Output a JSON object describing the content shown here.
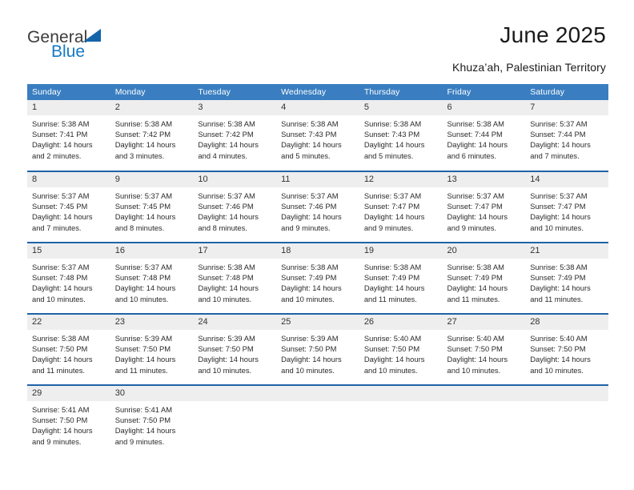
{
  "brand": {
    "name_top": "General",
    "name_bottom": "Blue",
    "triangle_color": "#1464aa",
    "blue_color": "#1479c4"
  },
  "header": {
    "title": "June 2025",
    "subtitle": "Khuza’ah, Palestinian Territory"
  },
  "theme": {
    "header_bg": "#3a7ec1",
    "row_rule": "#1f64a8",
    "daynum_bg": "#eeeeee"
  },
  "weekday_headers": [
    "Sunday",
    "Monday",
    "Tuesday",
    "Wednesday",
    "Thursday",
    "Friday",
    "Saturday"
  ],
  "weeks": [
    [
      {
        "day": "1",
        "text": "Sunrise: 5:38 AM\nSunset: 7:41 PM\nDaylight: 14 hours\nand 2 minutes."
      },
      {
        "day": "2",
        "text": "Sunrise: 5:38 AM\nSunset: 7:42 PM\nDaylight: 14 hours\nand 3 minutes."
      },
      {
        "day": "3",
        "text": "Sunrise: 5:38 AM\nSunset: 7:42 PM\nDaylight: 14 hours\nand 4 minutes."
      },
      {
        "day": "4",
        "text": "Sunrise: 5:38 AM\nSunset: 7:43 PM\nDaylight: 14 hours\nand 5 minutes."
      },
      {
        "day": "5",
        "text": "Sunrise: 5:38 AM\nSunset: 7:43 PM\nDaylight: 14 hours\nand 5 minutes."
      },
      {
        "day": "6",
        "text": "Sunrise: 5:38 AM\nSunset: 7:44 PM\nDaylight: 14 hours\nand 6 minutes."
      },
      {
        "day": "7",
        "text": "Sunrise: 5:37 AM\nSunset: 7:44 PM\nDaylight: 14 hours\nand 7 minutes."
      }
    ],
    [
      {
        "day": "8",
        "text": "Sunrise: 5:37 AM\nSunset: 7:45 PM\nDaylight: 14 hours\nand 7 minutes."
      },
      {
        "day": "9",
        "text": "Sunrise: 5:37 AM\nSunset: 7:45 PM\nDaylight: 14 hours\nand 8 minutes."
      },
      {
        "day": "10",
        "text": "Sunrise: 5:37 AM\nSunset: 7:46 PM\nDaylight: 14 hours\nand 8 minutes."
      },
      {
        "day": "11",
        "text": "Sunrise: 5:37 AM\nSunset: 7:46 PM\nDaylight: 14 hours\nand 9 minutes."
      },
      {
        "day": "12",
        "text": "Sunrise: 5:37 AM\nSunset: 7:47 PM\nDaylight: 14 hours\nand 9 minutes."
      },
      {
        "day": "13",
        "text": "Sunrise: 5:37 AM\nSunset: 7:47 PM\nDaylight: 14 hours\nand 9 minutes."
      },
      {
        "day": "14",
        "text": "Sunrise: 5:37 AM\nSunset: 7:47 PM\nDaylight: 14 hours\nand 10 minutes."
      }
    ],
    [
      {
        "day": "15",
        "text": "Sunrise: 5:37 AM\nSunset: 7:48 PM\nDaylight: 14 hours\nand 10 minutes."
      },
      {
        "day": "16",
        "text": "Sunrise: 5:37 AM\nSunset: 7:48 PM\nDaylight: 14 hours\nand 10 minutes."
      },
      {
        "day": "17",
        "text": "Sunrise: 5:38 AM\nSunset: 7:48 PM\nDaylight: 14 hours\nand 10 minutes."
      },
      {
        "day": "18",
        "text": "Sunrise: 5:38 AM\nSunset: 7:49 PM\nDaylight: 14 hours\nand 10 minutes."
      },
      {
        "day": "19",
        "text": "Sunrise: 5:38 AM\nSunset: 7:49 PM\nDaylight: 14 hours\nand 11 minutes."
      },
      {
        "day": "20",
        "text": "Sunrise: 5:38 AM\nSunset: 7:49 PM\nDaylight: 14 hours\nand 11 minutes."
      },
      {
        "day": "21",
        "text": "Sunrise: 5:38 AM\nSunset: 7:49 PM\nDaylight: 14 hours\nand 11 minutes."
      }
    ],
    [
      {
        "day": "22",
        "text": "Sunrise: 5:38 AM\nSunset: 7:50 PM\nDaylight: 14 hours\nand 11 minutes."
      },
      {
        "day": "23",
        "text": "Sunrise: 5:39 AM\nSunset: 7:50 PM\nDaylight: 14 hours\nand 11 minutes."
      },
      {
        "day": "24",
        "text": "Sunrise: 5:39 AM\nSunset: 7:50 PM\nDaylight: 14 hours\nand 10 minutes."
      },
      {
        "day": "25",
        "text": "Sunrise: 5:39 AM\nSunset: 7:50 PM\nDaylight: 14 hours\nand 10 minutes."
      },
      {
        "day": "26",
        "text": "Sunrise: 5:40 AM\nSunset: 7:50 PM\nDaylight: 14 hours\nand 10 minutes."
      },
      {
        "day": "27",
        "text": "Sunrise: 5:40 AM\nSunset: 7:50 PM\nDaylight: 14 hours\nand 10 minutes."
      },
      {
        "day": "28",
        "text": "Sunrise: 5:40 AM\nSunset: 7:50 PM\nDaylight: 14 hours\nand 10 minutes."
      }
    ],
    [
      {
        "day": "29",
        "text": "Sunrise: 5:41 AM\nSunset: 7:50 PM\nDaylight: 14 hours\nand 9 minutes."
      },
      {
        "day": "30",
        "text": "Sunrise: 5:41 AM\nSunset: 7:50 PM\nDaylight: 14 hours\nand 9 minutes."
      },
      {
        "day": "",
        "text": ""
      },
      {
        "day": "",
        "text": ""
      },
      {
        "day": "",
        "text": ""
      },
      {
        "day": "",
        "text": ""
      },
      {
        "day": "",
        "text": ""
      }
    ]
  ]
}
